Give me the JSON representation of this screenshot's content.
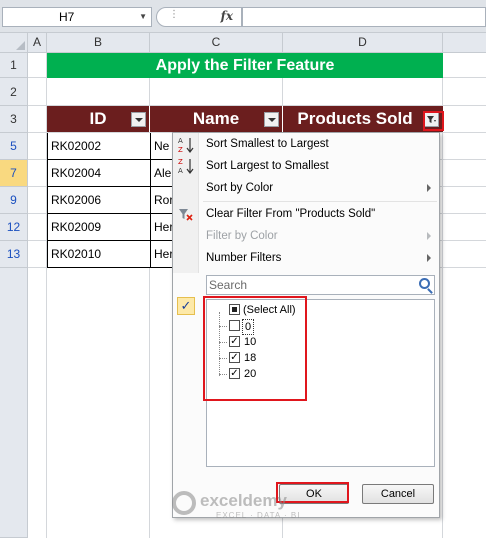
{
  "formula_bar": {
    "name_box": "H7",
    "fx_symbol": "fx"
  },
  "columns": [
    "A",
    "B",
    "C",
    "D"
  ],
  "rows": [
    "1",
    "2",
    "3",
    "5",
    "7",
    "9",
    "12",
    "13"
  ],
  "title": "Apply the Filter Feature",
  "table": {
    "headers": [
      "ID",
      "Name",
      "Products Sold"
    ],
    "ids": [
      "RK02002",
      "RK02004",
      "RK02006",
      "RK02009",
      "RK02010"
    ],
    "names_partial": [
      "Ne",
      "Ale",
      "Ror",
      "Her",
      "Her"
    ]
  },
  "filter_menu": {
    "sort_asc": "Sort Smallest to Largest",
    "sort_desc": "Sort Largest to Smallest",
    "sort_color": "Sort by Color",
    "clear_filter": "Clear Filter From \"Products Sold\"",
    "filter_color": "Filter by Color",
    "number_filters": "Number Filters",
    "search_placeholder": "Search",
    "select_all": "(Select All)",
    "values": [
      "0",
      "10",
      "18",
      "20"
    ],
    "ok": "OK",
    "cancel": "Cancel"
  },
  "watermark": {
    "name": "exceldemy",
    "tagline": "EXCEL · DATA · BI"
  }
}
